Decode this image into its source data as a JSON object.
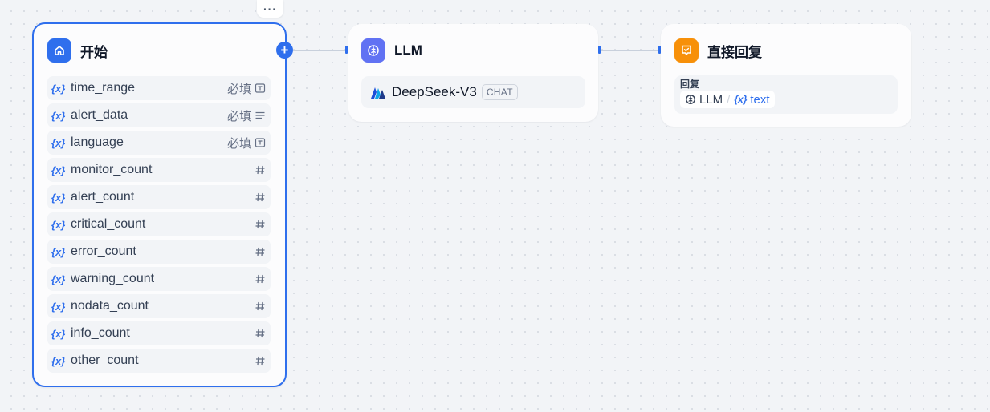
{
  "start_node": {
    "title": "开始",
    "icon": "home-icon",
    "accent": "#2f6fed",
    "variables": [
      {
        "name": "time_range",
        "required": "必填",
        "type_icon": "text-input-icon"
      },
      {
        "name": "alert_data",
        "required": "必填",
        "type_icon": "paragraph-icon"
      },
      {
        "name": "language",
        "required": "必填",
        "type_icon": "text-input-icon"
      },
      {
        "name": "monitor_count",
        "required": "",
        "type_icon": "number-icon"
      },
      {
        "name": "alert_count",
        "required": "",
        "type_icon": "number-icon"
      },
      {
        "name": "critical_count",
        "required": "",
        "type_icon": "number-icon"
      },
      {
        "name": "error_count",
        "required": "",
        "type_icon": "number-icon"
      },
      {
        "name": "warning_count",
        "required": "",
        "type_icon": "number-icon"
      },
      {
        "name": "nodata_count",
        "required": "",
        "type_icon": "number-icon"
      },
      {
        "name": "info_count",
        "required": "",
        "type_icon": "number-icon"
      },
      {
        "name": "other_count",
        "required": "",
        "type_icon": "number-icon"
      }
    ],
    "var_marker": "{x}",
    "more_button": "···",
    "add_button": "+"
  },
  "llm_node": {
    "title": "LLM",
    "accent": "#6172f3",
    "model_name": "DeepSeek-V3",
    "model_badge": "CHAT"
  },
  "answer_node": {
    "title": "直接回复",
    "accent": "#f79009",
    "reply_label": "回复",
    "reply_source": "LLM",
    "reply_separator": "/",
    "reply_var_marker": "{x}",
    "reply_var": "text"
  },
  "colors": {
    "canvas_bg": "#f2f4f7",
    "node_bg": "#fcfcfd",
    "selected_border": "#2f6fed",
    "handle": "#2f6fed",
    "connector": "#c8d0dc"
  }
}
